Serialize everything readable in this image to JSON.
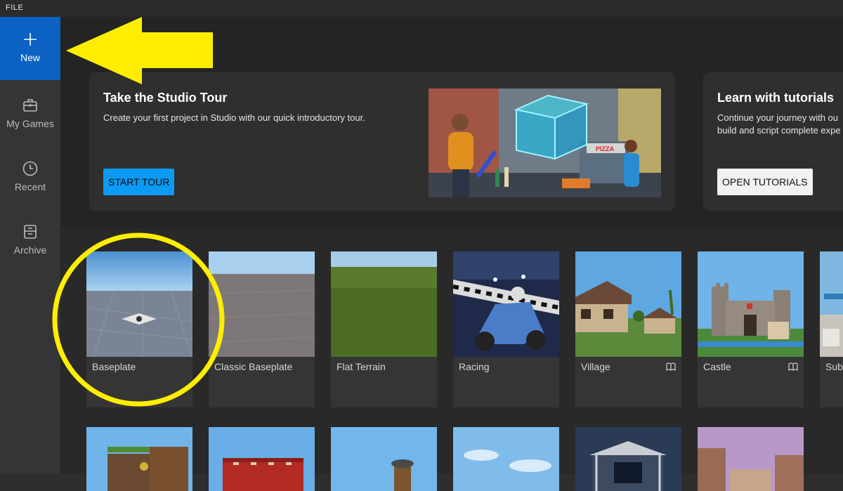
{
  "menu": {
    "file": "FILE"
  },
  "sidebar": {
    "items": [
      {
        "label": "New",
        "icon": "plus-icon",
        "active": true
      },
      {
        "label": "My Games",
        "icon": "briefcase-icon"
      },
      {
        "label": "Recent",
        "icon": "clock-icon"
      },
      {
        "label": "Archive",
        "icon": "archive-box-icon"
      }
    ]
  },
  "banners": {
    "tour": {
      "title": "Take the Studio Tour",
      "description": "Create your first project in Studio with our quick introductory tour.",
      "button": "START TOUR"
    },
    "tutorials": {
      "title": "Learn with tutorials",
      "description": "Continue your journey with ou build and script complete expe",
      "line1": "Continue your journey with ou",
      "line2": "build and script complete expe",
      "button": "OPEN TUTORIALS"
    }
  },
  "templates": [
    {
      "label": "Baseplate"
    },
    {
      "label": "Classic Baseplate"
    },
    {
      "label": "Flat Terrain"
    },
    {
      "label": "Racing"
    },
    {
      "label": "Village",
      "icon": "book-icon"
    },
    {
      "label": "Castle",
      "icon": "book-icon"
    },
    {
      "label": "Sub"
    }
  ],
  "colors": {
    "accent": "#0b62c2",
    "button_blue": "#0c9af2",
    "highlight_yellow": "#ffee00",
    "sidebar": "#353535",
    "background": "#292929"
  }
}
